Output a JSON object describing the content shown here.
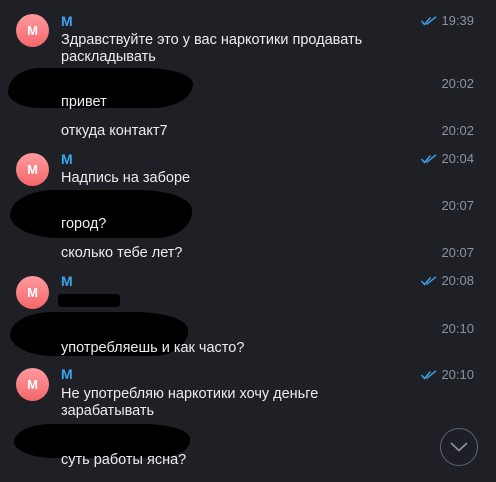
{
  "messages": [
    {
      "sender": "M",
      "avatar": "M",
      "text": "Здравствуйте это у вас наркотики продавать раскладывать",
      "time": "19:39",
      "read": true
    },
    {
      "text": "привет",
      "time": "20:02"
    },
    {
      "text": "откуда контакт7",
      "time": "20:02"
    },
    {
      "sender": "M",
      "avatar": "M",
      "text": "Надпись на заборе",
      "time": "20:04",
      "read": true
    },
    {
      "text": "город?",
      "time": "20:07"
    },
    {
      "text": "сколько тебе лет?",
      "time": "20:07"
    },
    {
      "sender": "M",
      "avatar": "M",
      "text": "",
      "time": "20:08",
      "read": true
    },
    {
      "text": "употребляешь и как часто?",
      "time": "20:10"
    },
    {
      "sender": "M",
      "avatar": "M",
      "text": "Не употребляю наркотики хочу деньге зарабатывать",
      "time": "20:10",
      "read": true
    },
    {
      "text": "суть работы ясна?",
      "time": ""
    }
  ],
  "icons": {
    "read_receipt": "double-check-icon",
    "scroll_down": "chevron-down-icon"
  },
  "colors": {
    "background": "#1e2026",
    "sender_name": "#3aa6f0",
    "timestamp": "#8a93a0",
    "read_check": "#3aa6f0",
    "avatar_gradient_top": "#ff9a9e",
    "avatar_gradient_bottom": "#f5676a",
    "redaction": "#000000"
  }
}
